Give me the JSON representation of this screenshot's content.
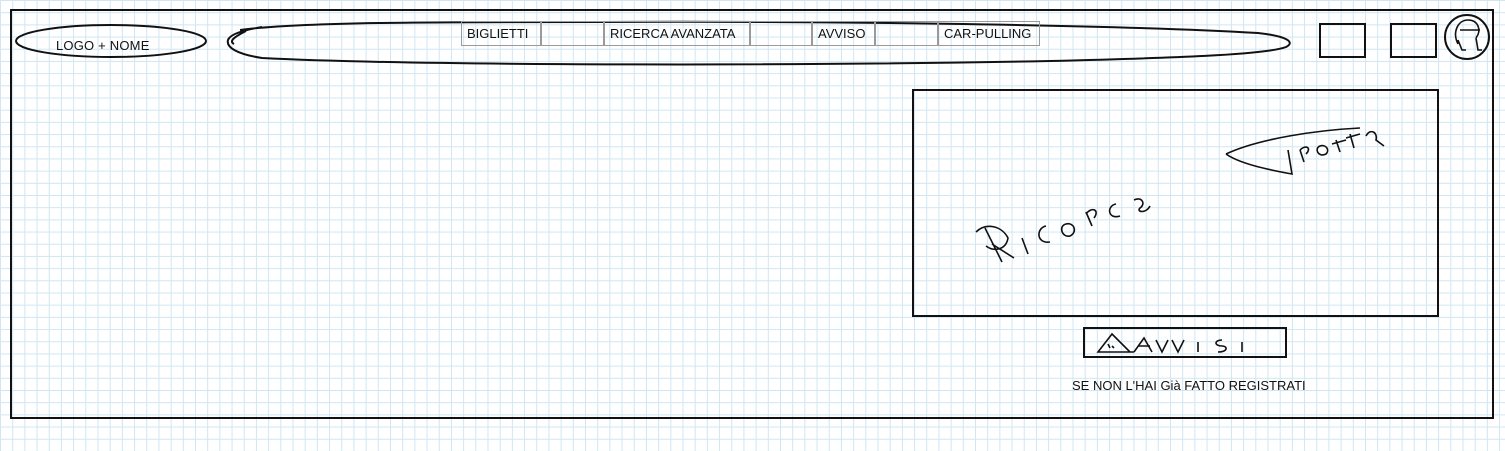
{
  "logo": {
    "text": "LOGO + NOME"
  },
  "nav": {
    "items": [
      {
        "label": "BIGLIETTI"
      },
      {
        "label": ""
      },
      {
        "label": "RICERCA AVANZATA"
      },
      {
        "label": ""
      },
      {
        "label": "AVVISO"
      },
      {
        "label": ""
      },
      {
        "label": "CAR-PULLING"
      }
    ]
  },
  "header": {
    "icons": [
      "square-icon",
      "square-icon",
      "user-avatar-icon"
    ]
  },
  "main": {
    "search_panel": {
      "handwritten_label": "Ricerca Tratta"
    },
    "avvisi_button": {
      "handwritten_label": "Avvisi",
      "icon": "warning-triangle-icon"
    },
    "register_text": "SE NON L'HAI Già FATTO REGISTRATI"
  },
  "colors": {
    "ink": "#111111",
    "grid": "#cfe6f4",
    "nav_border": "#9a9a9a"
  }
}
